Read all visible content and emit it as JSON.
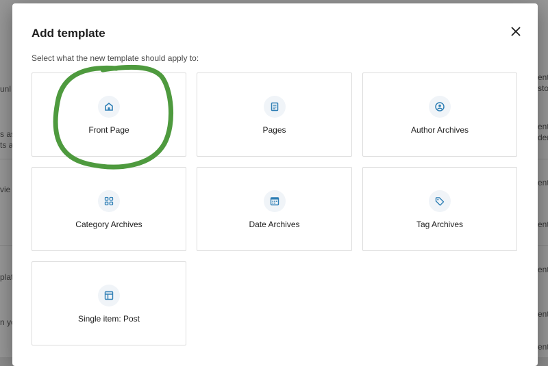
{
  "background": {
    "right_texts": [
      "ent",
      "stor",
      "ent",
      "der",
      "ent",
      "ent",
      "ent",
      "ent",
      "ent"
    ],
    "left_texts": [
      "unl",
      "s as",
      "ts a",
      "vie",
      "plat",
      "n yo"
    ]
  },
  "modal": {
    "title": "Add template",
    "close_icon": "close-icon",
    "subtitle": "Select what the new template should apply to:"
  },
  "templates": [
    {
      "label": "Front Page",
      "icon": "home-icon"
    },
    {
      "label": "Pages",
      "icon": "page-icon"
    },
    {
      "label": "Author Archives",
      "icon": "user-icon"
    },
    {
      "label": "Category Archives",
      "icon": "category-icon"
    },
    {
      "label": "Date Archives",
      "icon": "calendar-icon"
    },
    {
      "label": "Tag Archives",
      "icon": "tag-icon"
    },
    {
      "label": "Single item: Post",
      "icon": "post-layout-icon"
    }
  ],
  "colors": {
    "accent": "#3858e9",
    "icon_blue": "#2f7fb5",
    "annotation_green": "#4e9a3e"
  }
}
